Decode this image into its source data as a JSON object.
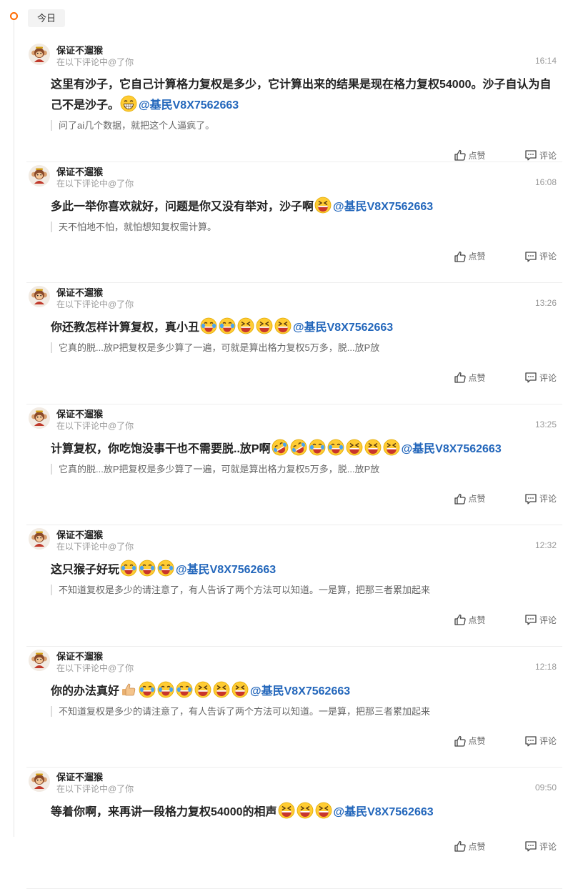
{
  "date_chip": "今日",
  "comments": [
    {
      "user": "保证不遛猴",
      "subtitle": "在以下评论中@了你",
      "time": "16:14",
      "text": "这里有沙子，它自己计算格力复权是多少，它计算出来的结果是现在格力复权54000。沙子自认为自己不是沙子。",
      "emojis": [
        "grin"
      ],
      "mention": "@基民V8X7562663",
      "quote": "问了ai几个数据，就把这个人逼疯了。",
      "like_label": "点赞",
      "comment_label": "评论"
    },
    {
      "user": "保证不遛猴",
      "subtitle": "在以下评论中@了你",
      "time": "16:08",
      "text": "多此一举你喜欢就好，问题是你又没有举对，沙子啊",
      "emojis": [
        "xd"
      ],
      "mention": "@基民V8X7562663",
      "quote": "天不怕地不怕，就怕想知复权需计算。",
      "like_label": "点赞",
      "comment_label": "评论"
    },
    {
      "user": "保证不遛猴",
      "subtitle": "在以下评论中@了你",
      "time": "13:26",
      "text": "你还教怎样计算复权，真小丑",
      "emojis": [
        "cry-laugh",
        "cry-laugh",
        "xd",
        "xd",
        "xd"
      ],
      "mention": "@基民V8X7562663",
      "quote": "它真的脱...放P把复权是多少算了一遍，可就是算出格力复权5万多，脱...放P放",
      "like_label": "点赞",
      "comment_label": "评论"
    },
    {
      "user": "保证不遛猴",
      "subtitle": "在以下评论中@了你",
      "time": "13:25",
      "text": "计算复权，你吃饱没事干也不需要脱..放P啊",
      "emojis": [
        "rofl",
        "rofl",
        "cry-laugh",
        "cry-laugh",
        "xd",
        "xd",
        "xd"
      ],
      "mention": "@基民V8X7562663",
      "quote": "它真的脱...放P把复权是多少算了一遍，可就是算出格力复权5万多，脱...放P放",
      "like_label": "点赞",
      "comment_label": "评论"
    },
    {
      "user": "保证不遛猴",
      "subtitle": "在以下评论中@了你",
      "time": "12:32",
      "text": "这只猴子好玩",
      "emojis": [
        "cry-laugh",
        "cry-laugh",
        "cry-laugh"
      ],
      "mention": "@基民V8X7562663",
      "quote": "不知道复权是多少的请注意了，有人告诉了两个方法可以知道。一是算，把那三者累加起来",
      "like_label": "点赞",
      "comment_label": "评论"
    },
    {
      "user": "保证不遛猴",
      "subtitle": "在以下评论中@了你",
      "time": "12:18",
      "text": "你的办法真好",
      "emojis": [
        "thumbs-up",
        "cry-laugh",
        "cry-laugh",
        "cry-laugh",
        "xd",
        "xd",
        "xd"
      ],
      "mention": "@基民V8X7562663",
      "quote": "不知道复权是多少的请注意了，有人告诉了两个方法可以知道。一是算，把那三者累加起来",
      "like_label": "点赞",
      "comment_label": "评论"
    },
    {
      "user": "保证不遛猴",
      "subtitle": "在以下评论中@了你",
      "time": "09:50",
      "text": "等着你啊，来再讲一段格力复权54000的相声",
      "emojis": [
        "xd",
        "xd",
        "xd"
      ],
      "mention": "@基民V8X7562663",
      "quote": "",
      "like_label": "点赞",
      "comment_label": "评论"
    }
  ],
  "colors": {
    "accent": "#ff6a00",
    "mention": "#2266bb",
    "emoji_yellow": "#ffcc33",
    "emoji_mouth": "#c8352b"
  }
}
